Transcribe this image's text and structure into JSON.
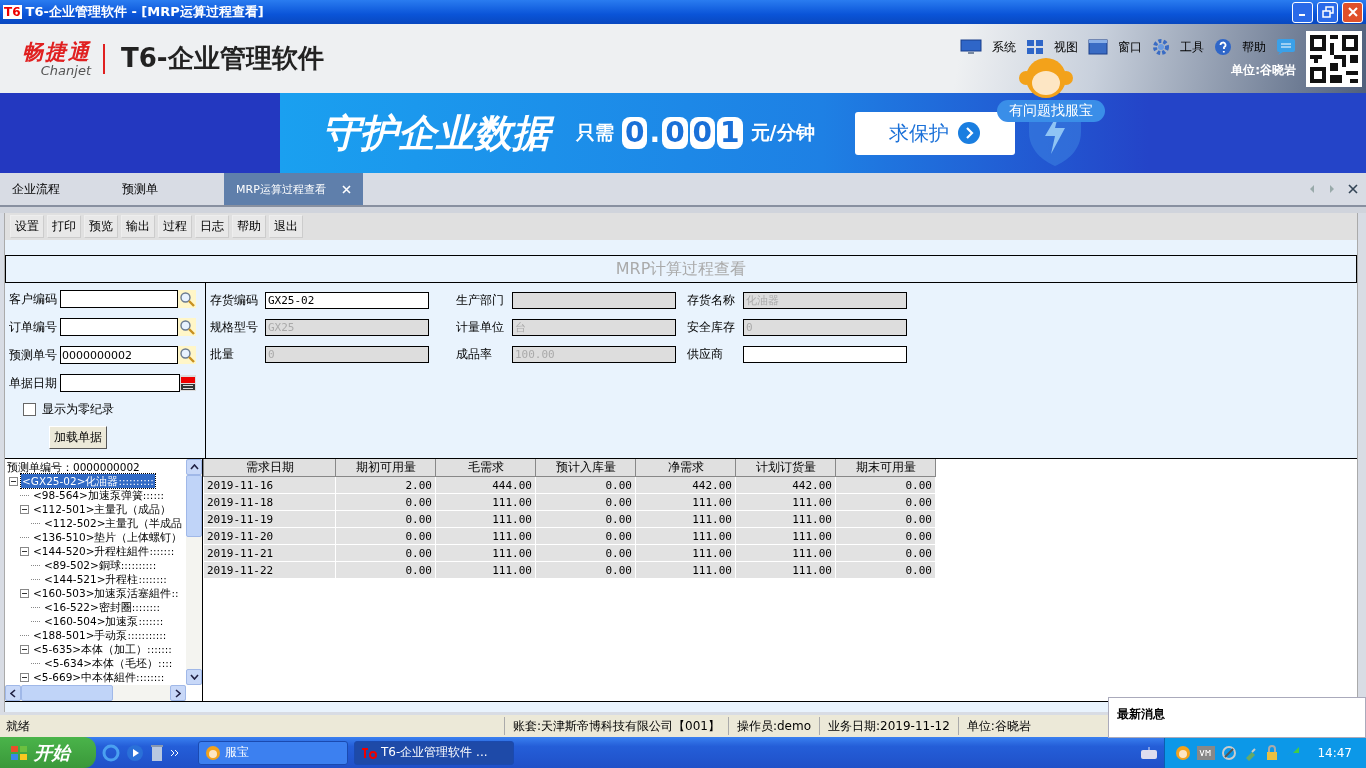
{
  "window": {
    "icon": "T6",
    "title": "T6-企业管理软件 - [MRP运算过程查看]"
  },
  "header": {
    "brand": "畅捷通",
    "brand_sub": "Chanjet",
    "product": "T6-企业管理软件",
    "menu": [
      {
        "label": "系统",
        "kind": "monitor"
      },
      {
        "label": "视图",
        "kind": "tiles"
      },
      {
        "label": "窗口",
        "kind": "window"
      },
      {
        "label": "工具",
        "kind": "gear"
      },
      {
        "label": "帮助",
        "kind": "help"
      }
    ],
    "unit": "单位:谷晓岩"
  },
  "banner": {
    "headline": "守护企业数据",
    "price_prefix": "只需",
    "price_digits": [
      "0",
      ".",
      "0",
      "0",
      "1"
    ],
    "price_suffix": "元/分钟",
    "button": "求保护",
    "bubble": "有问题找服宝"
  },
  "tabs": [
    {
      "label": "企业流程",
      "selected": false,
      "closable": false
    },
    {
      "label": "预测单",
      "selected": false,
      "closable": false
    },
    {
      "label": "MRP运算过程查看",
      "selected": true,
      "closable": true
    }
  ],
  "toolbar": [
    "设置",
    "打印",
    "预览",
    "输出",
    "过程",
    "日志",
    "帮助",
    "退出"
  ],
  "form": {
    "title": "MRP计算过程查看",
    "filters": [
      {
        "label": "客户编码",
        "kind": "lookup"
      },
      {
        "label": "订单编号",
        "kind": "lookup"
      },
      {
        "label": "预测单号",
        "value": "0000000002",
        "kind": "lookup"
      },
      {
        "label": "单据日期",
        "kind": "date"
      }
    ],
    "show_zero": {
      "label": "显示为零纪录",
      "checked": false
    },
    "load_button": "加载单据",
    "fields": [
      {
        "label": "存货编码",
        "value": "GX25-02",
        "disabled": false
      },
      {
        "label": "生产部门",
        "disabled": true
      },
      {
        "label": "存货名称",
        "value": "化油器",
        "disabled": true
      },
      {
        "label": "规格型号",
        "value": "GX25",
        "disabled": true
      },
      {
        "label": "计量单位",
        "value": "台",
        "disabled": true
      },
      {
        "label": "安全库存",
        "value": "0",
        "disabled": true
      },
      {
        "label": "批量",
        "value": "0",
        "disabled": true
      },
      {
        "label": "成品率",
        "value": "100.00",
        "disabled": true
      },
      {
        "label": "供应商",
        "disabled": false
      }
    ]
  },
  "tree": {
    "header": "预测单编号：0000000002",
    "nodes": [
      {
        "label": "<GX25-02>化油器::::::::::",
        "selected": true,
        "expanded": true,
        "children": [
          {
            "label": "<98-564>加速泵弹簧::::::",
            "selected": false
          },
          {
            "label": "<112-501>主量孔（成品）",
            "selected": false,
            "expanded": true,
            "children": [
              {
                "label": "<112-502>主量孔（半成品",
                "selected": false
              }
            ]
          },
          {
            "label": "<136-510>垫片（上体螺钉）",
            "selected": false
          },
          {
            "label": "<144-520>升程柱組件:::::::",
            "selected": false,
            "expanded": true,
            "children": [
              {
                "label": "<89-502>銅球::::::::::",
                "selected": false
              },
              {
                "label": "<144-521>升程柱::::::::",
                "selected": false
              }
            ]
          },
          {
            "label": "<160-503>加速泵活塞組件::",
            "selected": false,
            "expanded": true,
            "children": [
              {
                "label": "<16-522>密封圈::::::::",
                "selected": false
              },
              {
                "label": "<160-504>加速泵:::::::",
                "selected": false
              }
            ]
          },
          {
            "label": "<188-501>手动泵:::::::::::",
            "selected": false
          },
          {
            "label": "<5-635>本体（加工）:::::::",
            "selected": false,
            "expanded": true,
            "children": [
              {
                "label": "<5-634>本体（毛坯）::::",
                "selected": false
              }
            ]
          },
          {
            "label": "<5-669>中本体組件::::::::",
            "selected": false,
            "expanded": true
          }
        ]
      }
    ]
  },
  "table": {
    "columns": [
      "需求日期",
      "期初可用量",
      "毛需求",
      "预计入库量",
      "净需求",
      "计划订货量",
      "期末可用量"
    ],
    "rows": [
      [
        "2019-11-16",
        "2.00",
        "444.00",
        "0.00",
        "442.00",
        "442.00",
        "0.00"
      ],
      [
        "2019-11-18",
        "0.00",
        "111.00",
        "0.00",
        "111.00",
        "111.00",
        "0.00"
      ],
      [
        "2019-11-19",
        "0.00",
        "111.00",
        "0.00",
        "111.00",
        "111.00",
        "0.00"
      ],
      [
        "2019-11-20",
        "0.00",
        "111.00",
        "0.00",
        "111.00",
        "111.00",
        "0.00"
      ],
      [
        "2019-11-21",
        "0.00",
        "111.00",
        "0.00",
        "111.00",
        "111.00",
        "0.00"
      ],
      [
        "2019-11-22",
        "0.00",
        "111.00",
        "0.00",
        "111.00",
        "111.00",
        "0.00"
      ]
    ]
  },
  "status_bar": [
    "就绪",
    "账套:天津斯帝博科技有限公司【001】",
    "操作员:demo",
    "业务日期:2019-11-12",
    "单位:谷晓岩"
  ],
  "news": {
    "title": "最新消息"
  },
  "taskbar": {
    "start": "开始",
    "tasks": [
      {
        "label": "服宝",
        "kind": "mascot",
        "selected": false
      },
      {
        "label": "T6-企业管理软件 ...",
        "kind": "app",
        "selected": true
      }
    ],
    "clock": "14:47"
  }
}
